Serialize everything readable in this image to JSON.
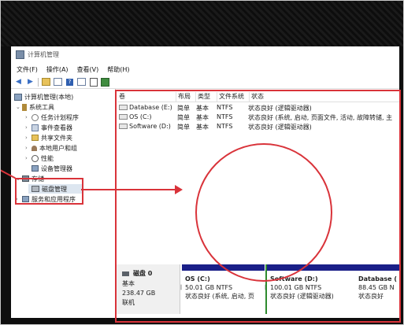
{
  "window": {
    "title": "计算机管理"
  },
  "menu": [
    "文件(F)",
    "操作(A)",
    "查看(V)",
    "帮助(H)"
  ],
  "toolbar": [
    "back-icon",
    "forward-icon",
    "folder-icon",
    "list-icon",
    "help-icon",
    "properties-icon",
    "export-icon",
    "refresh-icon"
  ],
  "tree": {
    "root": "计算机管理(本地)",
    "system_tools": "系统工具",
    "task_scheduler": "任务计划程序",
    "event_viewer": "事件查看器",
    "shared_folders": "共享文件夹",
    "local_users": "本地用户和组",
    "performance": "性能",
    "device_manager": "设备管理器",
    "storage": "存储",
    "disk_management": "磁盘管理",
    "services": "服务和应用程序"
  },
  "volumes": {
    "headers": [
      "卷",
      "布局",
      "类型",
      "文件系统",
      "状态"
    ],
    "rows": [
      [
        "Database (E:)",
        "简单",
        "基本",
        "NTFS",
        "状态良好 (逻辑驱动器)"
      ],
      [
        "OS (C:)",
        "简单",
        "基本",
        "NTFS",
        "状态良好 (系统, 启动, 页面文件, 活动, 故障转储, 主"
      ],
      [
        "Software (D:)",
        "简单",
        "基本",
        "NTFS",
        "状态良好 (逻辑驱动器)"
      ]
    ]
  },
  "disk0": {
    "name": "磁盘 0",
    "type": "基本",
    "size": "238.47 GB",
    "status": "联机",
    "partitions": [
      {
        "name": "OS (C:)",
        "size": "50.01 GB NTFS",
        "status": "状态良好 (系统, 启动, 页"
      },
      {
        "name": "Software (D:)",
        "size": "100.01 GB NTFS",
        "status": "状态良好 (逻辑驱动器)"
      },
      {
        "name": "Database (",
        "size": "88.45 GB N",
        "status": "状态良好"
      }
    ]
  },
  "colors": {
    "annotation": "#d9333a",
    "partition_band": "#1a1f88",
    "partition_selected": "#2e8b2e"
  }
}
